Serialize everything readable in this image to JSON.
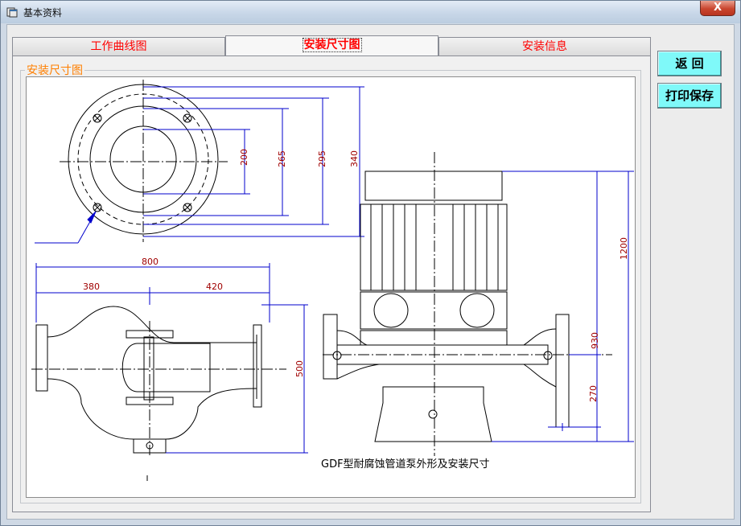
{
  "window": {
    "title": "基本资料",
    "close_label": "X"
  },
  "tabs": [
    {
      "label": "工作曲线图",
      "active": false
    },
    {
      "label": "安装尺寸图",
      "active": true
    },
    {
      "label": "安装信息",
      "active": false
    }
  ],
  "groupbox": {
    "label": "安装尺寸图"
  },
  "buttons": {
    "back_label": "返  回",
    "print_save_label": "打印保存"
  },
  "drawing": {
    "caption": "GDF型耐腐蚀管道泵外形及安装尺寸",
    "flange_dims": [
      "200",
      "265",
      "295",
      "340"
    ],
    "side_dims": [
      "800",
      "380",
      "420",
      "500"
    ],
    "pump_dims": [
      "1200",
      "930",
      "270"
    ],
    "line_color": "#0000cc",
    "text_color": "#a00000"
  }
}
